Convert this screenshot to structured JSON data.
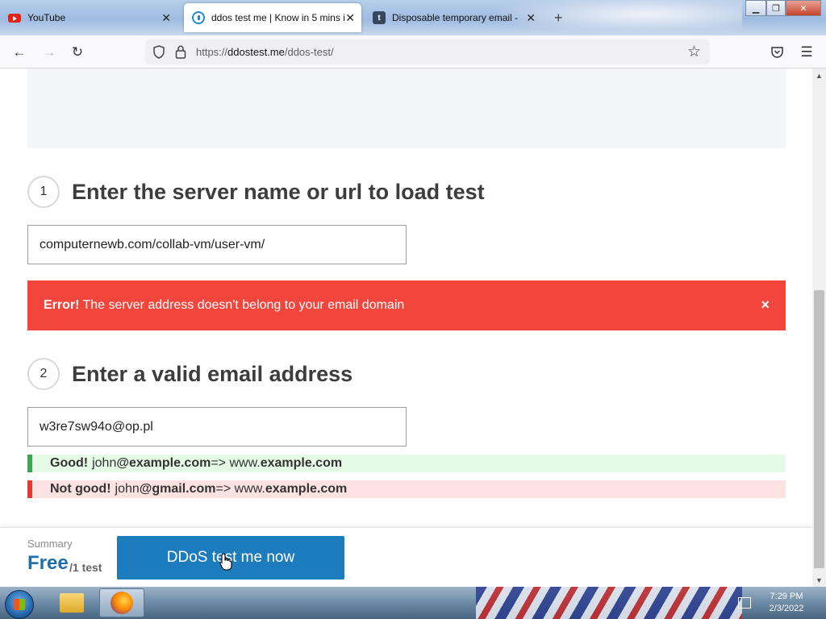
{
  "browser": {
    "tabs": [
      {
        "label": "YouTube",
        "icon": "youtube-icon"
      },
      {
        "label": "ddos test me | Know in 5 mins i",
        "icon": "ddostest-icon",
        "active": true
      },
      {
        "label": "Disposable temporary email -",
        "icon": "tumblr-t-icon"
      }
    ],
    "url": {
      "scheme": "https://",
      "host": "ddostest.me",
      "path": "/ddos-test/"
    }
  },
  "page": {
    "step1": {
      "number": "1",
      "title": "Enter the server name or url to load test",
      "value": "computernewb.com/collab-vm/user-vm/"
    },
    "alert": {
      "prefix": "Error!",
      "message": "The server address doesn't belong to your email domain",
      "close": "×"
    },
    "step2": {
      "number": "2",
      "title": "Enter a valid email address",
      "value": "w3re7sw94o@op.pl"
    },
    "good": {
      "label": "Good!",
      "user": "john",
      "domain": "@example.com",
      "arrow": "=> www.",
      "site": "example.com"
    },
    "bad": {
      "label": "Not good!",
      "user": "john",
      "domain": "@gmail.com",
      "arrow": "=> www.",
      "site": "example.com"
    },
    "summary": {
      "label": "Summary",
      "price": "Free",
      "unit": "/1 test",
      "button": "DDoS test me now"
    }
  },
  "taskbar": {
    "time": "7:29 PM",
    "date": "2/3/2022"
  },
  "colors": {
    "alert": "#f2453c",
    "button": "#1c7cbd",
    "good": "#3aa655",
    "bad": "#e53935"
  }
}
